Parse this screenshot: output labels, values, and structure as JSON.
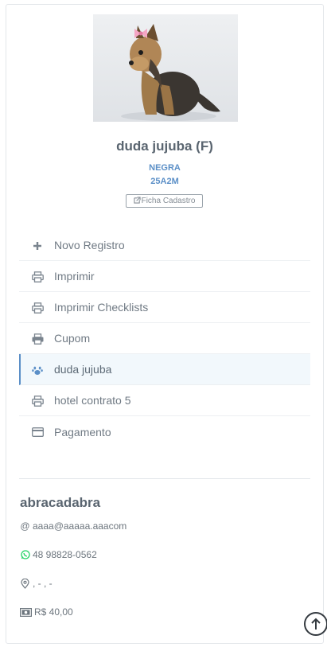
{
  "pet": {
    "name": "duda jujuba (F)",
    "breed_color": "NEGRA",
    "code": "25A2M",
    "ficha_label": "Ficha Cadastro",
    "photo_icon": "dog-photo"
  },
  "menu": {
    "items": [
      {
        "label": "Novo Registro",
        "icon": "plus-icon"
      },
      {
        "label": "Imprimir",
        "icon": "printer-icon"
      },
      {
        "label": "Imprimir Checklists",
        "icon": "printer-icon"
      },
      {
        "label": "Cupom",
        "icon": "printer-solid-icon"
      },
      {
        "label": "duda jujuba",
        "icon": "paw-icon",
        "active": true
      },
      {
        "label": "hotel contrato 5",
        "icon": "printer-icon"
      },
      {
        "label": "Pagamento",
        "icon": "credit-card-icon"
      }
    ]
  },
  "owner": {
    "name": "abracadabra",
    "email": "aaaa@aaaaa.aaacom",
    "phone": "48 98828-0562",
    "address": ", - , -",
    "balance": "R$ 40,00"
  },
  "colors": {
    "accent": "#5b8fc7",
    "whatsapp": "#25d366",
    "text": "#6c757d"
  }
}
